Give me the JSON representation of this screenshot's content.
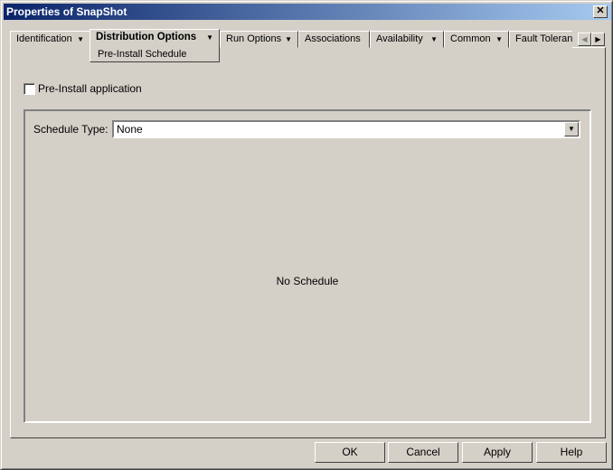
{
  "window": {
    "title": "Properties of SnapShot",
    "close": "✕"
  },
  "tabs": [
    {
      "label": "Identification",
      "dropdown": true
    },
    {
      "label": "Distribution Options",
      "dropdown": true,
      "active": true,
      "sub": "Pre-Install Schedule"
    },
    {
      "label": "Run Options",
      "dropdown": true
    },
    {
      "label": "Associations",
      "dropdown": false
    },
    {
      "label": "Availability",
      "dropdown": true
    },
    {
      "label": "Common",
      "dropdown": true
    },
    {
      "label": "Fault Toleran",
      "dropdown": false
    }
  ],
  "tab_arrow": "▼",
  "scroll": {
    "left": "◀",
    "right": "▶"
  },
  "preinstall": {
    "label": "Pre-Install application",
    "checked": false
  },
  "schedule": {
    "label": "Schedule Type:",
    "value": "None",
    "message": "No Schedule"
  },
  "buttons": {
    "ok": "OK",
    "cancel": "Cancel",
    "apply": "Apply",
    "help": "Help"
  }
}
